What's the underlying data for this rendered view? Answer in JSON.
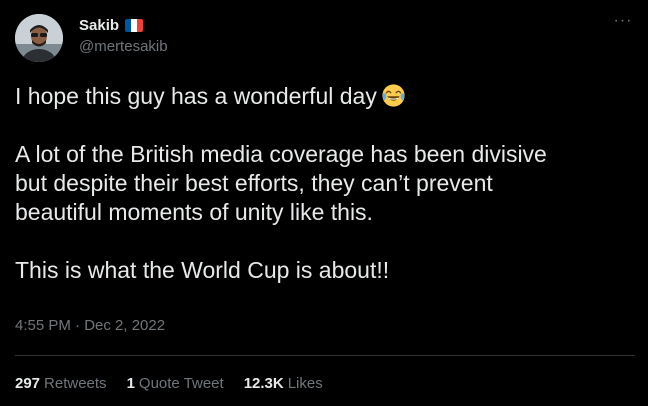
{
  "author": {
    "display_name": "Sakib",
    "handle": "@mertesakib",
    "flag_icon": "france-flag-icon",
    "flag_colors": [
      "#0055A4",
      "#FFFFFF",
      "#EF4135"
    ]
  },
  "tweet": {
    "line1": "I hope this guy has a wonderful day",
    "line1_emoji": "face-with-tears-of-joy-icon",
    "para2": "A lot of the British media coverage has been divisive\nbut despite their best efforts, they can’t prevent\nbeautiful moments of unity like this.",
    "para3": "This is what the World Cup is about!!",
    "timestamp": "4:55 PM · Dec 2, 2022"
  },
  "stats": {
    "retweets_count": "297",
    "retweets_label": "Retweets",
    "quotes_count": "1",
    "quotes_label": "Quote Tweet",
    "likes_count": "12.3K",
    "likes_label": "Likes"
  },
  "more_icon": "more-horizontal-icon",
  "colors": {
    "background": "#000000",
    "text_primary": "#e7e9ea",
    "text_secondary": "#71767b",
    "divider": "#2f3336"
  }
}
